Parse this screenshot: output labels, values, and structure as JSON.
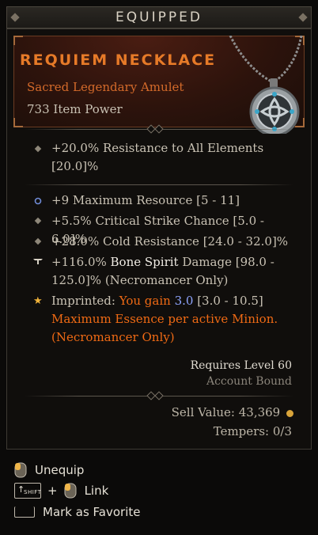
{
  "header": {
    "title": "EQUIPPED"
  },
  "item": {
    "name": "REQUIEM NECKLACE",
    "type": "Sacred Legendary Amulet",
    "power": "733 Item Power",
    "affix1_line1": "+20.0% Resistance to All Elements",
    "affix1_line2": "[20.0]%",
    "stat1": "+9 Maximum Resource [5 - 11]",
    "stat2": "+5.5% Critical Strike Chance [5.0 - 6.0]%",
    "stat3": "+28.0% Cold Resistance [24.0 - 32.0]%",
    "stat4_pre": "+116.0% ",
    "stat4_skill": "Bone Spirit",
    "stat4_post": " Damage [98.0 -",
    "stat4_line2": "125.0]% (Necromancer Only)",
    "imprint_label": "Imprinted: ",
    "imprint_text1": "You gain ",
    "imprint_value": "3.0",
    "imprint_range": " [3.0 - 10.5]",
    "imprint_line2": "Maximum Essence per active Minion.",
    "imprint_line3": "(Necromancer Only)",
    "requires": "Requires Level 60",
    "bound": "Account Bound",
    "sell_value": "Sell Value: 43,369",
    "tempers": "Tempers: 0/3"
  },
  "controls": {
    "unequip": "Unequip",
    "shift_key": "SHIFT",
    "plus": "+",
    "link": "Link",
    "favorite": "Mark as Favorite"
  },
  "colors": {
    "legendary": "#e67a28",
    "imprint": "#f06a14",
    "value_highlight": "#8fa5ff"
  },
  "icons": [
    "amulet-icon",
    "diamond-bullet-icon",
    "resource-bullet-icon",
    "skill-bullet-icon",
    "star-icon",
    "gold-coin-icon",
    "mouse-icon",
    "shift-key-icon",
    "spacebar-key-icon"
  ]
}
